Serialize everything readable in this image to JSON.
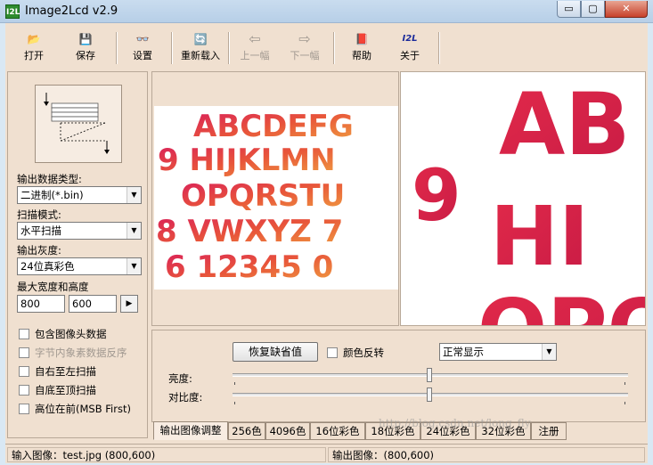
{
  "window": {
    "title": "Image2Lcd v2.9",
    "app_icon_text": "I2L",
    "min": "▭",
    "max": "▢",
    "close": "✕"
  },
  "toolbar": {
    "items": [
      {
        "label": "打开",
        "icon": "open-folder-icon",
        "glyph": "📂"
      },
      {
        "label": "保存",
        "icon": "save-disk-icon",
        "glyph": "💾"
      },
      {
        "label": "设置",
        "icon": "settings-glasses-icon",
        "glyph": "👓"
      },
      {
        "label": "重新载入",
        "icon": "reload-icon",
        "glyph": "🔄"
      },
      {
        "label": "上一幅",
        "icon": "prev-image-icon",
        "glyph": "⇦"
      },
      {
        "label": "下一幅",
        "icon": "next-image-icon",
        "glyph": "⇨"
      },
      {
        "label": "帮助",
        "icon": "help-book-icon",
        "glyph": "📕"
      },
      {
        "label": "关于",
        "icon": "about-i2l-icon",
        "glyph": "I2L"
      }
    ]
  },
  "left": {
    "output_type_label": "输出数据类型:",
    "output_type_value": "二进制(*.bin)",
    "scan_mode_label": "扫描模式:",
    "scan_mode_value": "水平扫描",
    "gray_label": "输出灰度:",
    "gray_value": "24位真彩色",
    "size_label": "最大宽度和高度",
    "max_width": "800",
    "max_height": "600",
    "size_btn": "▶",
    "checks": [
      {
        "label": "包含图像头数据",
        "enabled": true
      },
      {
        "label": "字节内象素数据反序",
        "enabled": false
      },
      {
        "label": "自右至左扫描",
        "enabled": true
      },
      {
        "label": "自底至顶扫描",
        "enabled": true
      },
      {
        "label": "高位在前(MSB First)",
        "enabled": true
      }
    ]
  },
  "images": {
    "source_lines": [
      "ABCDEFG",
      "9 HIJKLMN",
      "OPQRSTU",
      "8 VWXYZ 7",
      "6 12345 0"
    ],
    "output_lines": [
      "AB",
      "9",
      "HI",
      "OPO"
    ]
  },
  "controls": {
    "restore_default": "恢复缺省值",
    "invert_label": "颜色反转",
    "display_mode": "正常显示",
    "brightness_label": "亮度:",
    "contrast_label": "对比度:",
    "brightness_value": 0.5,
    "contrast_value": 0.5
  },
  "tabs": [
    "输出图像调整",
    "256色",
    "4096色",
    "16位彩色",
    "18位彩色",
    "24位彩色",
    "32位彩色",
    "注册"
  ],
  "status": {
    "input": "输入图像：test.jpg (800,600)",
    "output": "输出图像：(800,600)"
  },
  "watermark": "http://blog.csdn.net/long_fly",
  "colors": {
    "title_bg": "#c9dcef",
    "client_bg": "#f0e0d0",
    "letter_red": "#e0304a"
  }
}
